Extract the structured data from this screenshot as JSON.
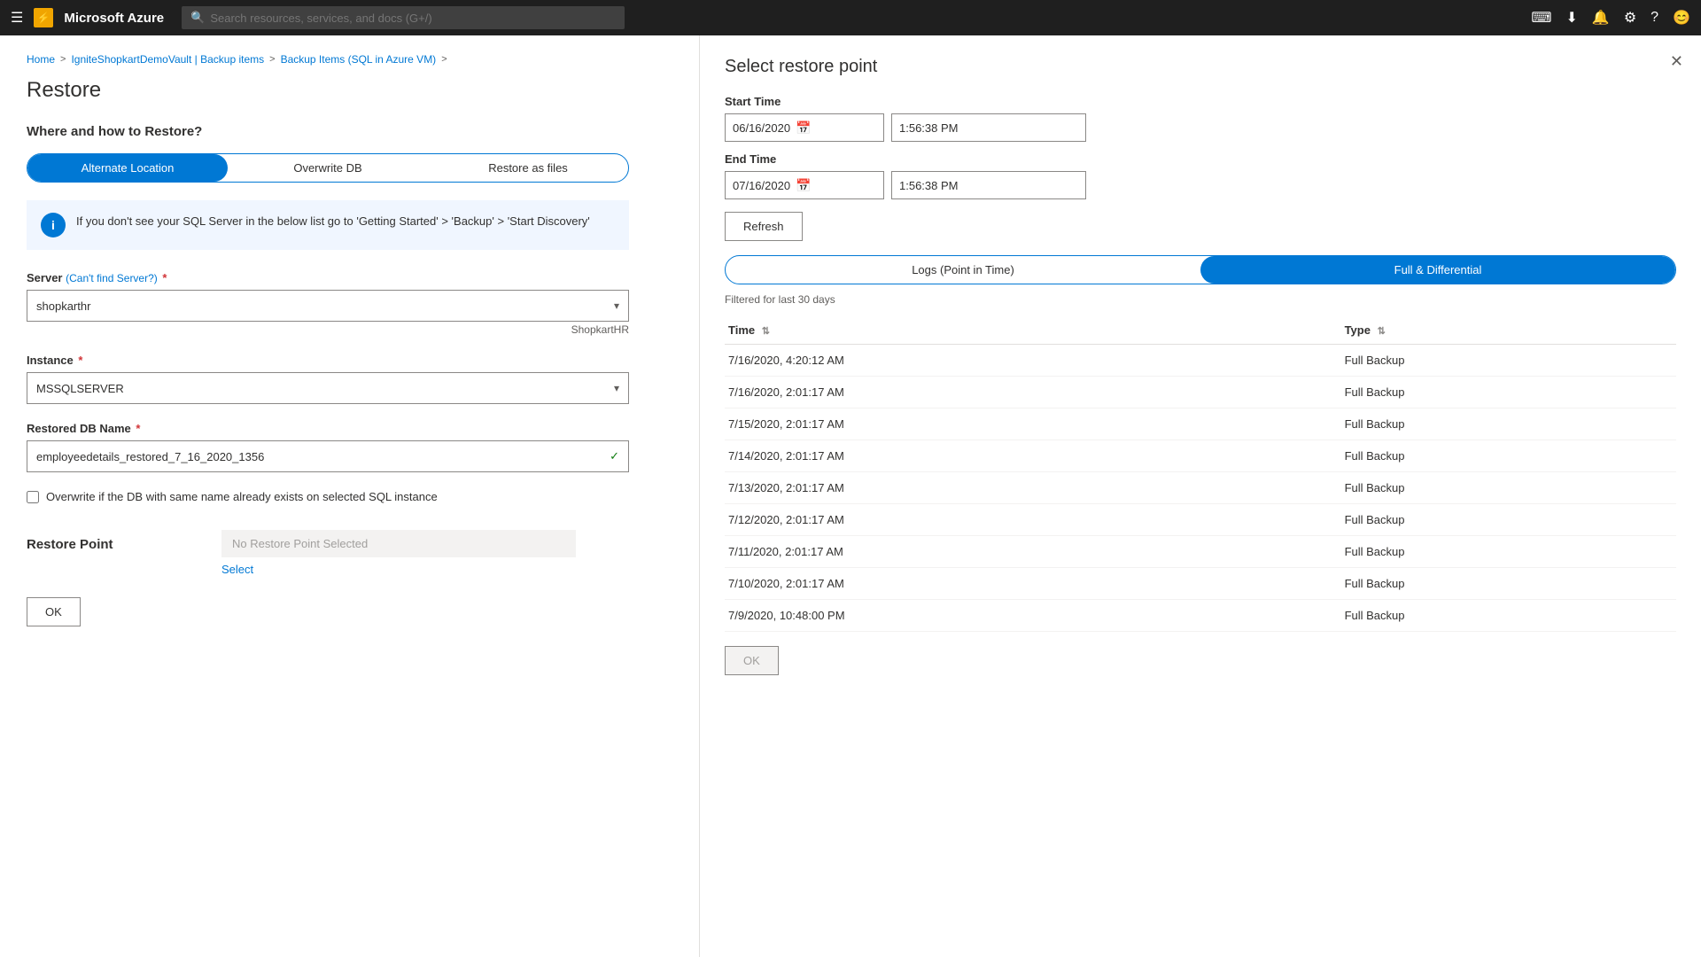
{
  "nav": {
    "hamburger": "☰",
    "logo_text": "Microsoft Azure",
    "search_placeholder": "Search resources, services, and docs (G+/)",
    "icons": [
      "⌨",
      "⬇",
      "🔔",
      "⚙",
      "?",
      "😊"
    ]
  },
  "breadcrumb": {
    "items": [
      "Home",
      "IgniteShopkartDemoVault | Backup items",
      "Backup Items (SQL in Azure VM)"
    ]
  },
  "restore": {
    "page_title": "Restore",
    "section_heading": "Where and how to Restore?",
    "toggle": {
      "options": [
        "Alternate Location",
        "Overwrite DB",
        "Restore as files"
      ],
      "active": 0
    },
    "info_message": "If you don't see your SQL Server in the below list go to 'Getting Started' > 'Backup' > 'Start Discovery'",
    "server_label": "Server",
    "server_note": "(Can't find Server?)",
    "server_required": "*",
    "server_value": "shopkarthr",
    "server_hint": "ShopkartHR",
    "instance_label": "Instance",
    "instance_required": "*",
    "instance_value": "MSSQLSERVER",
    "db_name_label": "Restored DB Name",
    "db_name_required": "*",
    "db_name_value": "employeedetails_restored_7_16_2020_1356",
    "checkbox_label": "Overwrite if the DB with same name already exists on selected SQL instance",
    "restore_point_section": "Restore Point",
    "restore_point_placeholder": "No Restore Point Selected",
    "select_link": "Select",
    "ok_label": "OK"
  },
  "panel": {
    "title": "Select restore point",
    "close_icon": "✕",
    "start_time_label": "Start Time",
    "start_date_value": "06/16/2020",
    "start_time_value": "1:56:38 PM",
    "end_time_label": "End Time",
    "end_date_value": "07/16/2020",
    "end_time_value": "1:56:38 PM",
    "refresh_label": "Refresh",
    "view_toggle": {
      "options": [
        "Logs (Point in Time)",
        "Full & Differential"
      ],
      "active": 1
    },
    "filter_text": "Filtered for last 30 days",
    "table": {
      "columns": [
        "Time",
        "Type"
      ],
      "rows": [
        {
          "time": "7/16/2020, 4:20:12 AM",
          "type": "Full Backup"
        },
        {
          "time": "7/16/2020, 2:01:17 AM",
          "type": "Full Backup"
        },
        {
          "time": "7/15/2020, 2:01:17 AM",
          "type": "Full Backup"
        },
        {
          "time": "7/14/2020, 2:01:17 AM",
          "type": "Full Backup"
        },
        {
          "time": "7/13/2020, 2:01:17 AM",
          "type": "Full Backup"
        },
        {
          "time": "7/12/2020, 2:01:17 AM",
          "type": "Full Backup"
        },
        {
          "time": "7/11/2020, 2:01:17 AM",
          "type": "Full Backup"
        },
        {
          "time": "7/10/2020, 2:01:17 AM",
          "type": "Full Backup"
        },
        {
          "time": "7/9/2020, 10:48:00 PM",
          "type": "Full Backup"
        }
      ]
    },
    "ok_label": "OK"
  }
}
